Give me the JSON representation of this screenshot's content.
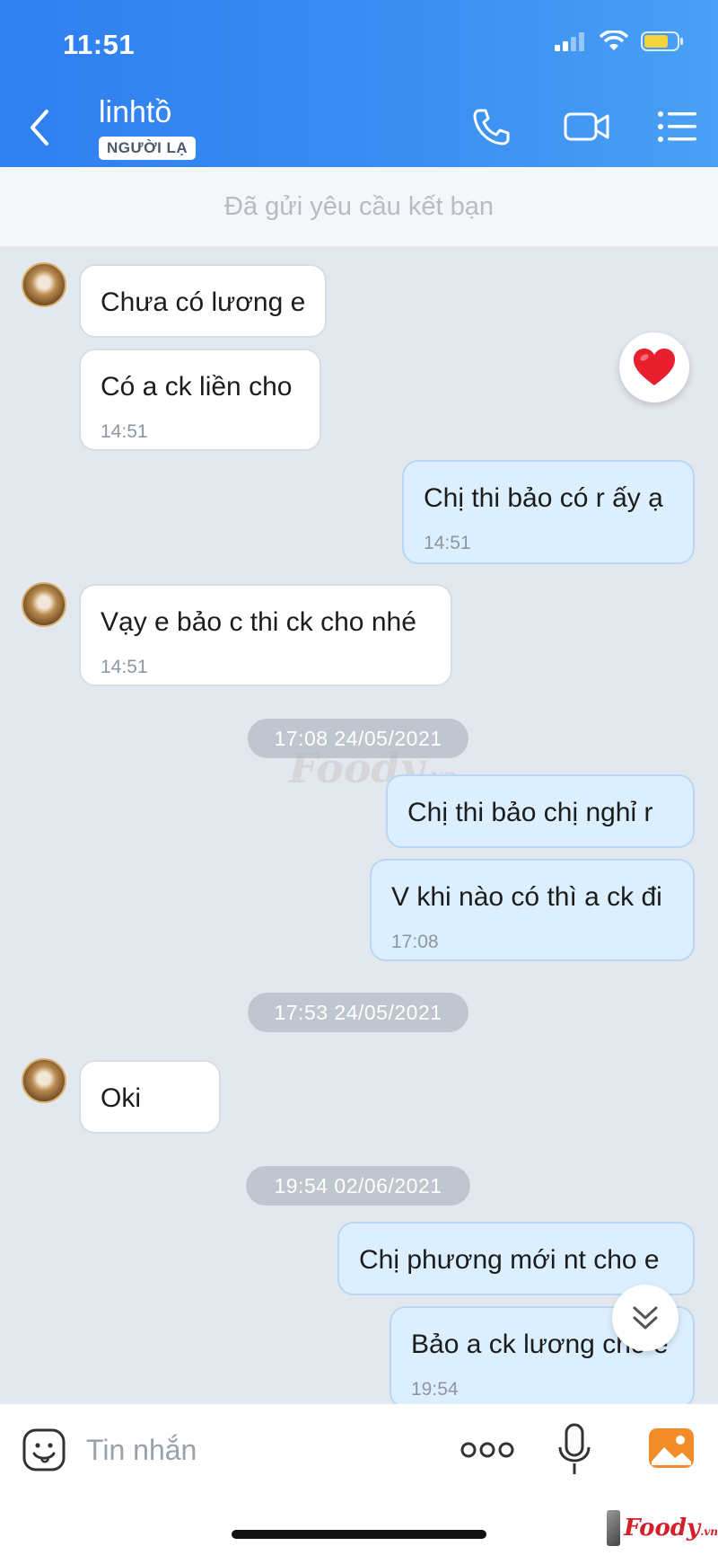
{
  "status_bar": {
    "time": "11:51"
  },
  "header": {
    "contact_name": "linhtồ",
    "badge": "NGƯỜI LẠ",
    "icons": [
      "back-arrow-icon",
      "phone-icon",
      "video-call-icon",
      "menu-list-icon"
    ]
  },
  "friend_request": {
    "text": "Đã gửi yêu cầu kết bạn"
  },
  "messages": [
    {
      "direction": "in",
      "text": "Chưa có lương e",
      "time": ""
    },
    {
      "direction": "in",
      "text": "Có a ck liền cho",
      "time": "14:51",
      "reaction": "heart"
    },
    {
      "direction": "out",
      "text": "Chị thi bảo có r ấy ạ",
      "time": "14:51"
    },
    {
      "direction": "in",
      "text": "Vạy e bảo c thi ck cho nhé",
      "time": "14:51"
    },
    {
      "direction": "out",
      "text": "Chị thi bảo chị nghỉ r",
      "time": ""
    },
    {
      "direction": "out",
      "text": "V khi nào có thì a ck đi",
      "time": "17:08"
    },
    {
      "direction": "in",
      "text": "Oki",
      "time": ""
    },
    {
      "direction": "out",
      "text": "Chị phương mới nt cho e",
      "time": ""
    },
    {
      "direction": "out",
      "text": "Bảo a ck lương cho e",
      "time": "19:54"
    }
  ],
  "date_separators": [
    "17:08 24/05/2021",
    "17:53 24/05/2021",
    "19:54 02/06/2021"
  ],
  "watermark": {
    "main": "Foody",
    "suffix": ".vn"
  },
  "input_bar": {
    "placeholder": "Tin nhắn",
    "icons": [
      "sticker-icon",
      "more-dots-icon",
      "microphone-icon",
      "photo-icon"
    ]
  },
  "brand": {
    "main": "Foody",
    "suffix": ".vn"
  },
  "colors": {
    "header": "#3b8ff2",
    "outgoing_bubble": "#dcefff",
    "incoming_bubble": "#ffffff",
    "chat_bg": "#e3e8ef",
    "reaction": "#e8202e"
  }
}
